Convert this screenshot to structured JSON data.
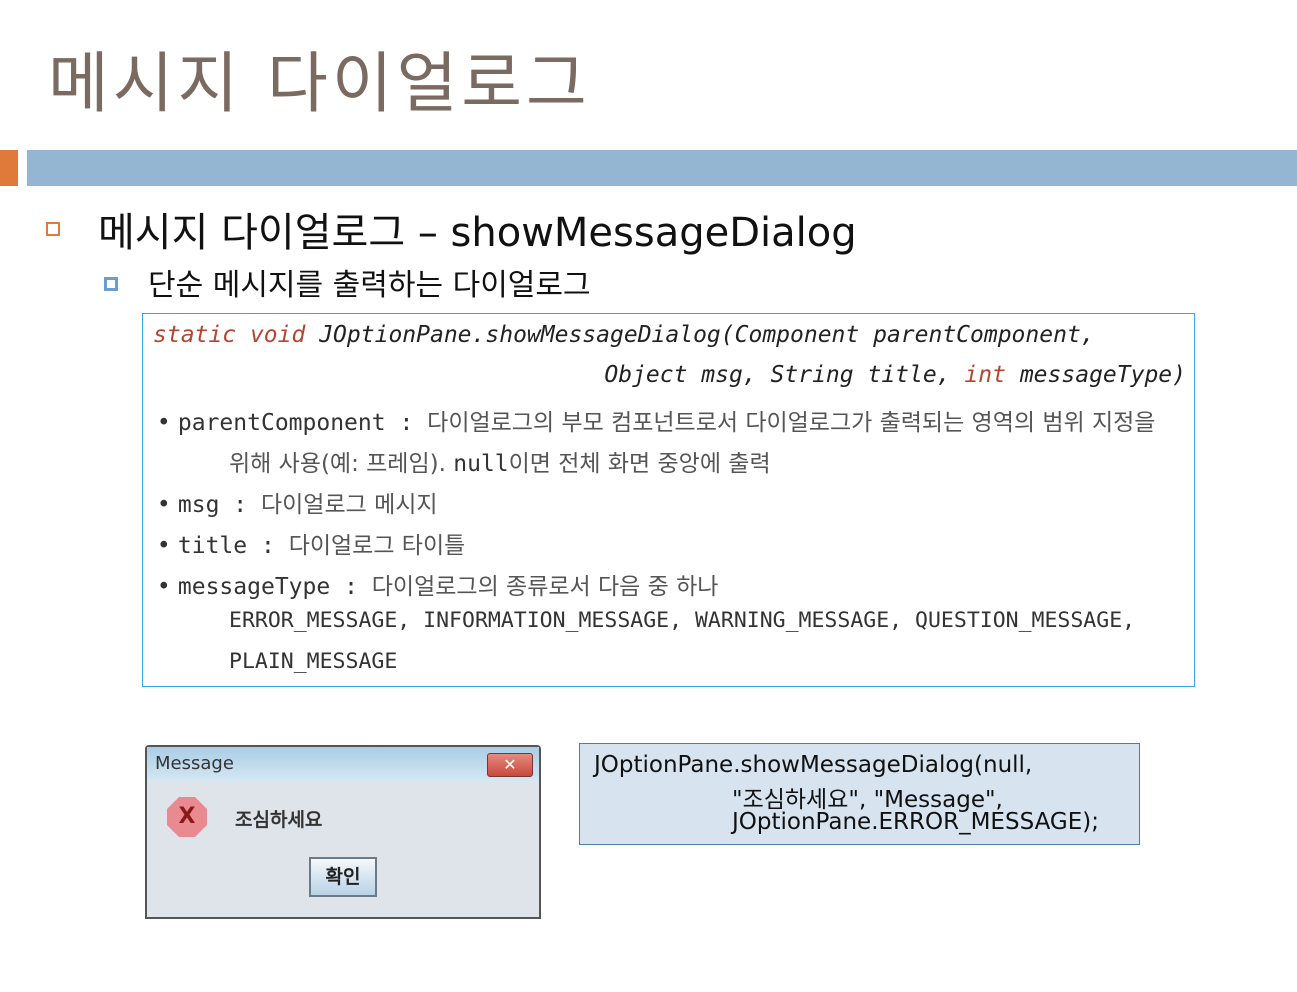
{
  "slide": {
    "title": "메시지 다이얼로그",
    "heading": "메시지 다이얼로그 – showMessageDialog",
    "subheading": "단순 메시지를 출력하는 다이얼로그"
  },
  "signature": {
    "static": "static",
    "void": "void",
    "sig1": "JOptionPane.showMessageDialog(Component parentComponent,",
    "sig2a": "Object msg, String title,",
    "int": "int",
    "sig2b": "messageType)"
  },
  "params": [
    {
      "name": "parentComponent",
      "sep": " : ",
      "desc": "다이얼로그의 부모 컴포넌트로서 다이얼로그가 출력되는 영역의 범위 지정을",
      "desc2a": "위해 사용(예: 프레임). ",
      "desc2null": "null",
      "desc2b": "이면 전체 화면 중앙에 출력"
    },
    {
      "name": "msg",
      "sep": " : ",
      "desc": "다이얼로그 메시지"
    },
    {
      "name": "title",
      "sep": " : ",
      "desc": "다이얼로그 타이틀"
    },
    {
      "name": "messageType",
      "sep": " : ",
      "desc": "다이얼로그의 종류로서 다음 중 하나",
      "values1": "ERROR_MESSAGE, INFORMATION_MESSAGE, WARNING_MESSAGE, QUESTION_MESSAGE,",
      "values2": "PLAIN_MESSAGE"
    }
  ],
  "dialog": {
    "title": "Message",
    "close": "✕",
    "icon": "error-icon",
    "message": "조심하세요",
    "ok": "확인"
  },
  "code": {
    "line1": "JOptionPane.showMessageDialog(null,",
    "line2": "\"조심하세요\", \"Message\",",
    "line3": "JOptionPane.ERROR_MESSAGE);"
  }
}
